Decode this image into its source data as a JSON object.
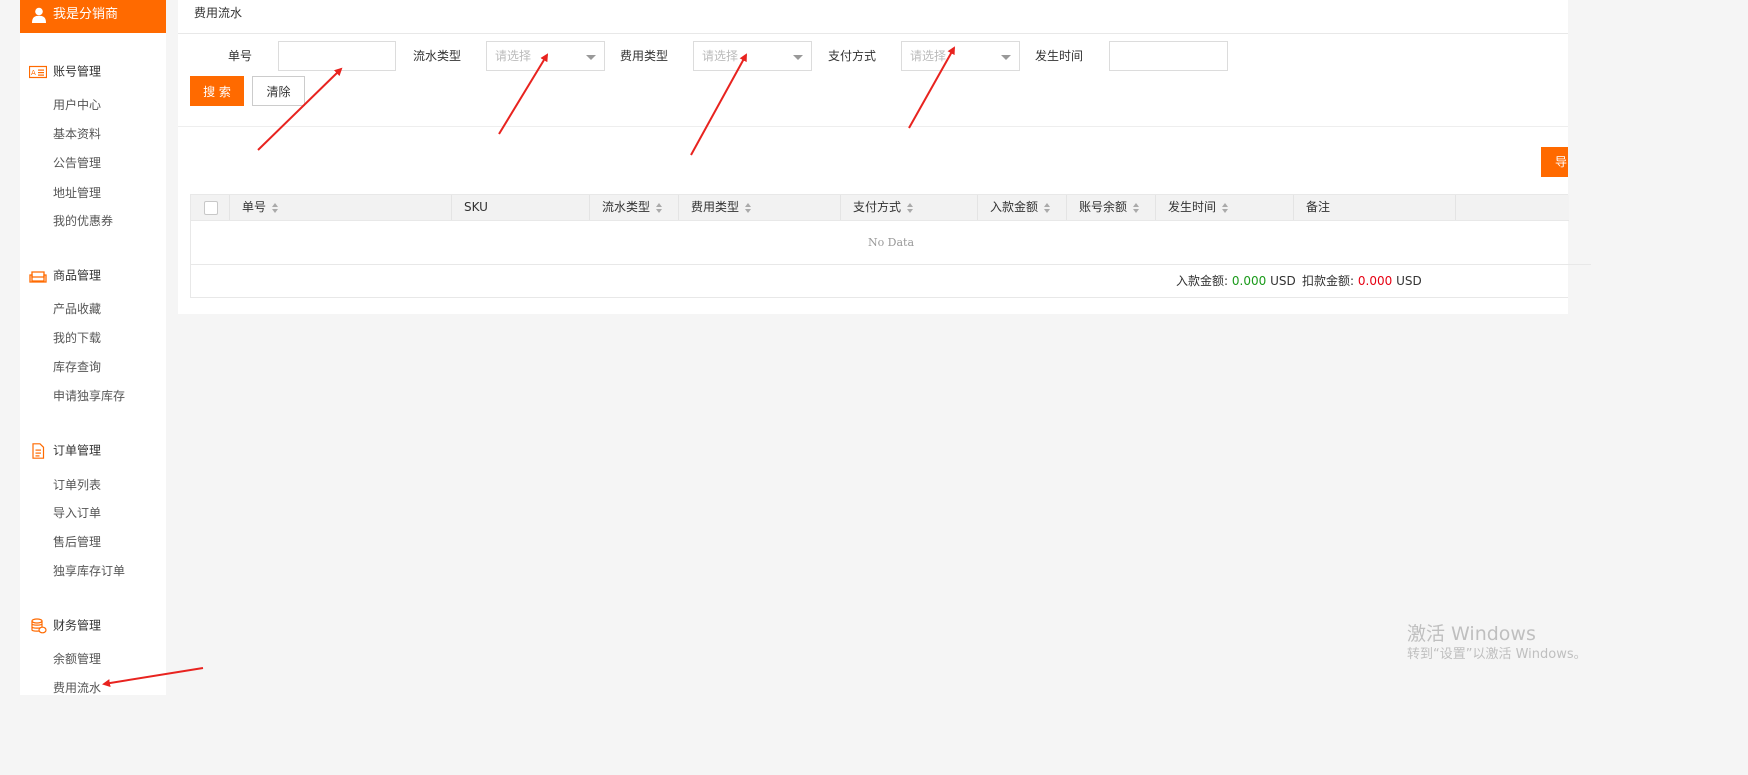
{
  "sidebar": {
    "header": "我是分销商",
    "sections": [
      {
        "title": "账号管理",
        "icon": "id-card-icon",
        "items": [
          "用户中心",
          "基本资料",
          "公告管理",
          "地址管理",
          "我的优惠券"
        ]
      },
      {
        "title": "商品管理",
        "icon": "sofa-icon",
        "items": [
          "产品收藏",
          "我的下载",
          "库存查询",
          "申请独享库存"
        ]
      },
      {
        "title": "订单管理",
        "icon": "document-icon",
        "items": [
          "订单列表",
          "导入订单",
          "售后管理",
          "独享库存订单"
        ]
      },
      {
        "title": "财务管理",
        "icon": "coins-icon",
        "items": [
          "余额管理",
          "费用流水"
        ]
      }
    ]
  },
  "page": {
    "title": "费用流水"
  },
  "filters": {
    "order_no_label": "单号",
    "flow_type_label": "流水类型",
    "fee_type_label": "费用类型",
    "pay_method_label": "支付方式",
    "time_label": "发生时间",
    "select_placeholder": "请选择",
    "order_no_value": "",
    "time_value": ""
  },
  "buttons": {
    "search": "搜 索",
    "clear": "清除",
    "export": "导"
  },
  "table": {
    "columns": [
      "单号",
      "SKU",
      "流水类型",
      "费用类型",
      "支付方式",
      "入款金额",
      "账号余额",
      "发生时间",
      "备注"
    ],
    "empty_text": "No Data"
  },
  "summary": {
    "income_label": "入款金额:",
    "income_value": "0.000",
    "deduct_label": "扣款金额:",
    "deduct_value": "0.000",
    "currency": "USD"
  },
  "watermark": {
    "line1": "激活 Windows",
    "line2": "转到“设置”以激活 Windows。"
  },
  "colors": {
    "accent": "#ff6a00",
    "income": "#1a9a1a",
    "deduct": "#e60012",
    "annotation_arrow": "#e8231f"
  }
}
